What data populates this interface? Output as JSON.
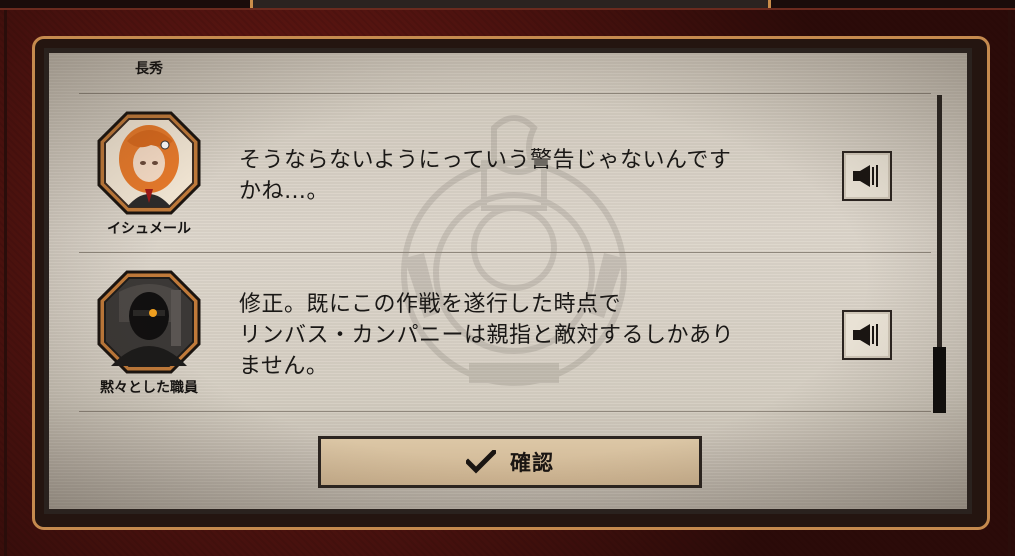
{
  "dialog": {
    "entries": [
      {
        "speaker": "長秀",
        "text": ""
      },
      {
        "speaker": "イシュメール",
        "text": "そうならないようにっていう警告じゃないんです\nかね…。",
        "portrait_icon": "ishmael-portrait-icon",
        "voice_icon": "speaker-icon"
      },
      {
        "speaker": "黙々とした職員",
        "text": "修正。既にこの作戦を遂行した時点で\nリンバス・カンパニーは親指と敵対するしかあり\nません。",
        "portrait_icon": "staff-portrait-icon",
        "voice_icon": "speaker-icon"
      }
    ],
    "confirm_label": "確認",
    "confirm_icon": "checkmark-icon"
  },
  "colors": {
    "frame_red": "#4a1410",
    "gold_border": "#c58a4e",
    "panel_bg": "#d6cfc3",
    "button_bg": "#dcc7a6",
    "ishmael_hair": "#e77a2b"
  }
}
